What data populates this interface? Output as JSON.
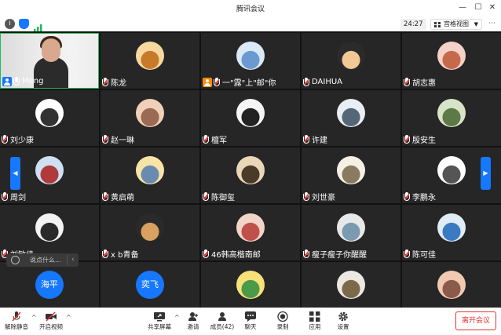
{
  "window": {
    "title": "腾讯会议"
  },
  "toolbar": {
    "timer": "24:27",
    "view_mode": "宫格视图"
  },
  "participants": [
    {
      "name": "Meng",
      "avatar": "video"
    },
    {
      "name": "陈龙",
      "avatar": "image"
    },
    {
      "name": "一\"露\"上\"邮\"你",
      "avatar": "image"
    },
    {
      "name": "DAIHUA",
      "avatar": "image"
    },
    {
      "name": "胡志惠",
      "avatar": "image"
    },
    {
      "name": "刘少康",
      "avatar": "image"
    },
    {
      "name": "赵一琳",
      "avatar": "image"
    },
    {
      "name": "檀军",
      "avatar": "image"
    },
    {
      "name": "许建",
      "avatar": "image"
    },
    {
      "name": "殷安生",
      "avatar": "image"
    },
    {
      "name": "周剑",
      "avatar": "image"
    },
    {
      "name": "黄启萌",
      "avatar": "image"
    },
    {
      "name": "陈御玺",
      "avatar": "image"
    },
    {
      "name": "刘世豪",
      "avatar": "image"
    },
    {
      "name": "李鹏永",
      "avatar": "image"
    },
    {
      "name": "刘敏佳",
      "avatar": "image"
    },
    {
      "name": "x b青备",
      "avatar": "image"
    },
    {
      "name": "46韩高楷南邮",
      "avatar": "image"
    },
    {
      "name": "瘦子瘦子你醒醒",
      "avatar": "image"
    },
    {
      "name": "陈可佳",
      "avatar": "image"
    },
    {
      "name": "",
      "avatar": "text",
      "avatar_text": "海平"
    },
    {
      "name": "",
      "avatar": "text",
      "avatar_text": "奕飞"
    },
    {
      "name": "",
      "avatar": "image"
    },
    {
      "name": "",
      "avatar": "image"
    },
    {
      "name": "",
      "avatar": "image"
    }
  ],
  "chat_input": {
    "placeholder": "说点什么..."
  },
  "bottom": {
    "unmute": "解除静音",
    "video": "开启视频",
    "share": "共享屏幕",
    "invite": "邀请",
    "members": "成员(42)",
    "chat": "聊天",
    "record": "录制",
    "apps": "应用",
    "settings": "设置",
    "leave": "离开会议"
  },
  "colors": {
    "accent": "#1677ff",
    "leave": "#e5322d",
    "active_border": "#1dbd5a"
  }
}
